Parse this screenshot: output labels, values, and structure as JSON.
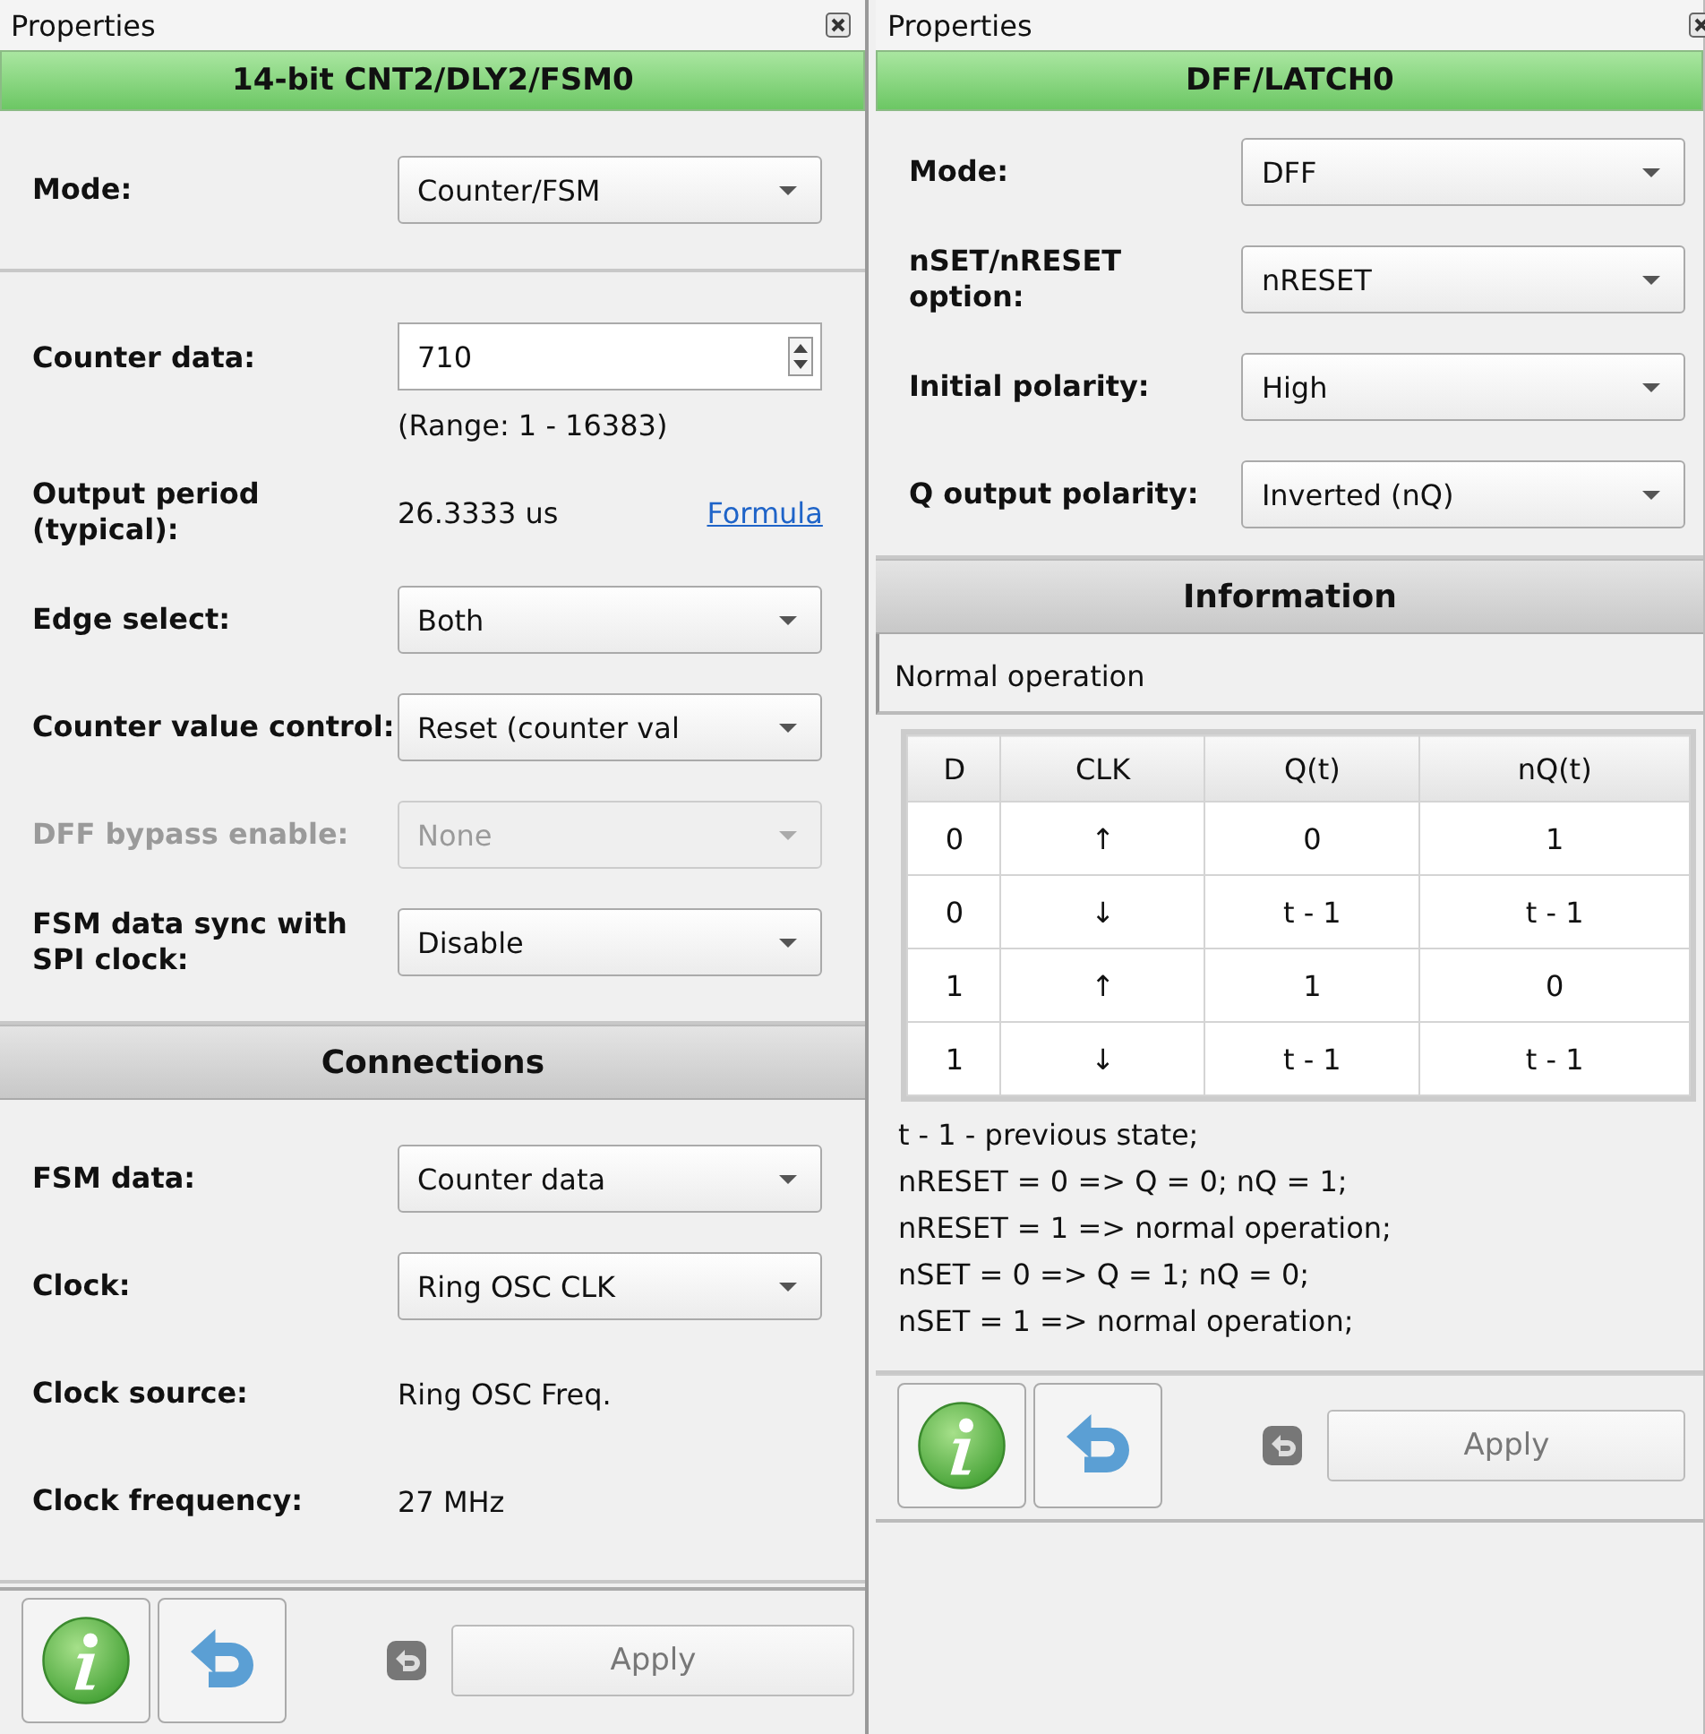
{
  "panels": [
    {
      "title": "Properties",
      "heading": "14-bit CNT2/DLY2/FSM0",
      "sections": [
        {
          "rows": [
            {
              "kind": "dropdown",
              "label": "Mode:",
              "value": "Counter/FSM",
              "disabled": false
            }
          ]
        },
        {
          "rows": [
            {
              "kind": "spin",
              "label": "Counter data:",
              "value": "710",
              "note": "(Range:  1 - 16383)"
            },
            {
              "kind": "link",
              "label": "Output period (typical):",
              "value": "26.3333 us",
              "link": "Formula"
            },
            {
              "kind": "dropdown",
              "label": "Edge select:",
              "value": "Both",
              "disabled": false
            },
            {
              "kind": "dropdown",
              "label": "Counter value control:",
              "value": "Reset (counter val",
              "disabled": false
            },
            {
              "kind": "dropdown",
              "label": "DFF bypass enable:",
              "value": "None",
              "disabled": true
            },
            {
              "kind": "dropdown",
              "label": "FSM data sync with SPI clock:",
              "value": "Disable",
              "disabled": false
            }
          ]
        },
        {
          "title": "Connections",
          "rows": [
            {
              "kind": "dropdown",
              "label": "FSM data:",
              "value": "Counter data",
              "disabled": false
            },
            {
              "kind": "dropdown",
              "label": "Clock:",
              "value": "Ring OSC CLK",
              "disabled": false
            },
            {
              "kind": "text",
              "label": "Clock source:",
              "value": "Ring OSC Freq."
            },
            {
              "kind": "text",
              "label": "Clock frequency:",
              "value": "27 MHz"
            }
          ]
        }
      ],
      "apply": "Apply"
    },
    {
      "title": "Properties",
      "heading": "DFF/LATCH0",
      "sections": [
        {
          "rows": [
            {
              "kind": "dropdown",
              "label": "Mode:",
              "value": "DFF",
              "disabled": false
            },
            {
              "kind": "dropdown",
              "label": "nSET/nRESET option:",
              "value": "nRESET",
              "disabled": false
            },
            {
              "kind": "dropdown",
              "label": "Initial polarity:",
              "value": "High",
              "disabled": false
            },
            {
              "kind": "dropdown",
              "label": "Q output polarity:",
              "value": "Inverted (nQ)",
              "disabled": false
            }
          ]
        },
        {
          "title": "Information",
          "info": {
            "caption": "Normal operation",
            "columns": [
              "D",
              "CLK",
              "Q(t)",
              "nQ(t)"
            ],
            "rows": [
              [
                "0",
                "↑",
                "0",
                "1"
              ],
              [
                "0",
                "↓",
                "t - 1",
                "t - 1"
              ],
              [
                "1",
                "↑",
                "1",
                "0"
              ],
              [
                "1",
                "↓",
                "t - 1",
                "t - 1"
              ]
            ],
            "notes": [
              "t - 1 - previous state;",
              "nRESET = 0 => Q = 0; nQ = 1;",
              "nRESET = 1 => normal operation;",
              "nSET = 0 => Q = 1; nQ = 0;",
              "nSET = 1 => normal operation;"
            ]
          }
        }
      ],
      "apply": "Apply"
    }
  ]
}
